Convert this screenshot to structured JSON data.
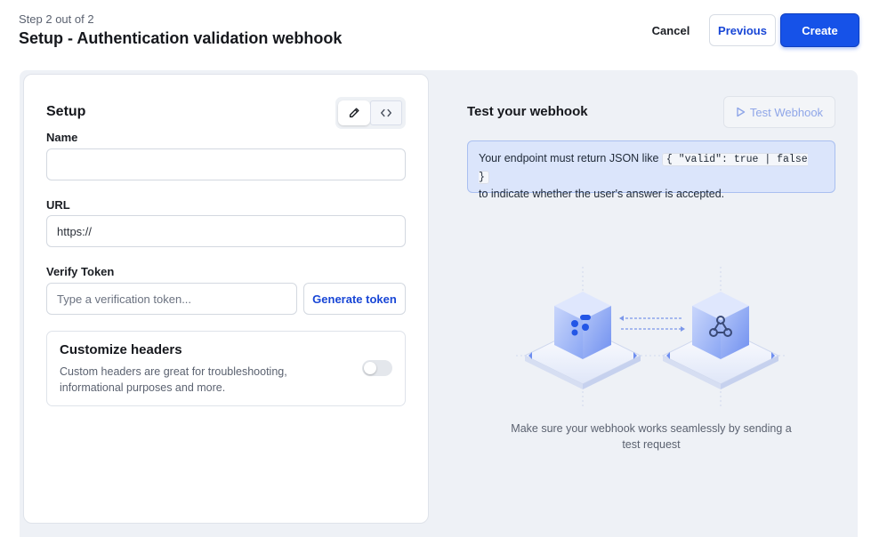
{
  "header": {
    "step": "Step 2 out of 2",
    "title": "Setup - Authentication validation webhook",
    "cancel_label": "Cancel",
    "previous_label": "Previous",
    "create_label": "Create"
  },
  "setup": {
    "title": "Setup",
    "mode_toggle": {
      "icons": [
        "pencil-icon",
        "code-icon"
      ],
      "active": "pencil-icon"
    },
    "name": {
      "label": "Name",
      "value": "",
      "placeholder": ""
    },
    "url": {
      "label": "URL",
      "value": "https://"
    },
    "verify_token": {
      "label": "Verify Token",
      "placeholder": "Type a verification token...",
      "generate_label": "Generate token"
    },
    "custom_headers": {
      "title": "Customize headers",
      "description": "Custom headers are great for troubleshooting, informational purposes and more.",
      "enabled": false
    }
  },
  "test": {
    "title": "Test your webhook",
    "button_label": "Test Webhook",
    "info_prefix": "Your endpoint must return JSON like",
    "info_code": "{ \"valid\": true | false }",
    "info_suffix": "to indicate whether the user's answer is accepted.",
    "footer": "Make sure your webhook works seamlessly by sending a test request"
  },
  "colors": {
    "primary": "#1652e8",
    "link": "#1846d6",
    "canvas": "#eef1f6",
    "info_bg": "#dbe5fb"
  }
}
